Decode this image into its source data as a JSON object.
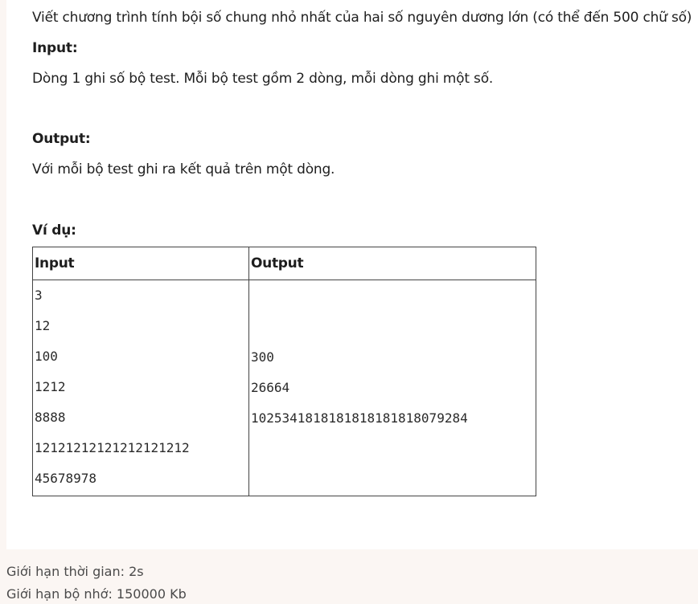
{
  "problem": {
    "statement": "Viết chương trình tính bội số chung nhỏ nhất của hai số nguyên dương lớn (có thể đến 500 chữ số)",
    "input_heading": "Input:",
    "input_text": "Dòng 1 ghi số bộ test. Mỗi bộ test gồm 2 dòng, mỗi dòng ghi một số.",
    "output_heading": "Output:",
    "output_text": "Với mỗi bộ test ghi ra kết quả trên một dòng.",
    "example_heading": "Ví dụ:"
  },
  "example_table": {
    "headers": [
      "Input",
      "Output"
    ],
    "input_lines": [
      "3",
      "12",
      "100",
      "1212",
      "8888",
      "12121212121212121212",
      "45678978"
    ],
    "output_lines": [
      "300",
      "26664",
      "1025341818181818181818079284"
    ]
  },
  "limits": {
    "time": "Giới hạn thời gian: 2s",
    "memory": "Giới hạn bộ nhớ: 150000 Kb"
  }
}
